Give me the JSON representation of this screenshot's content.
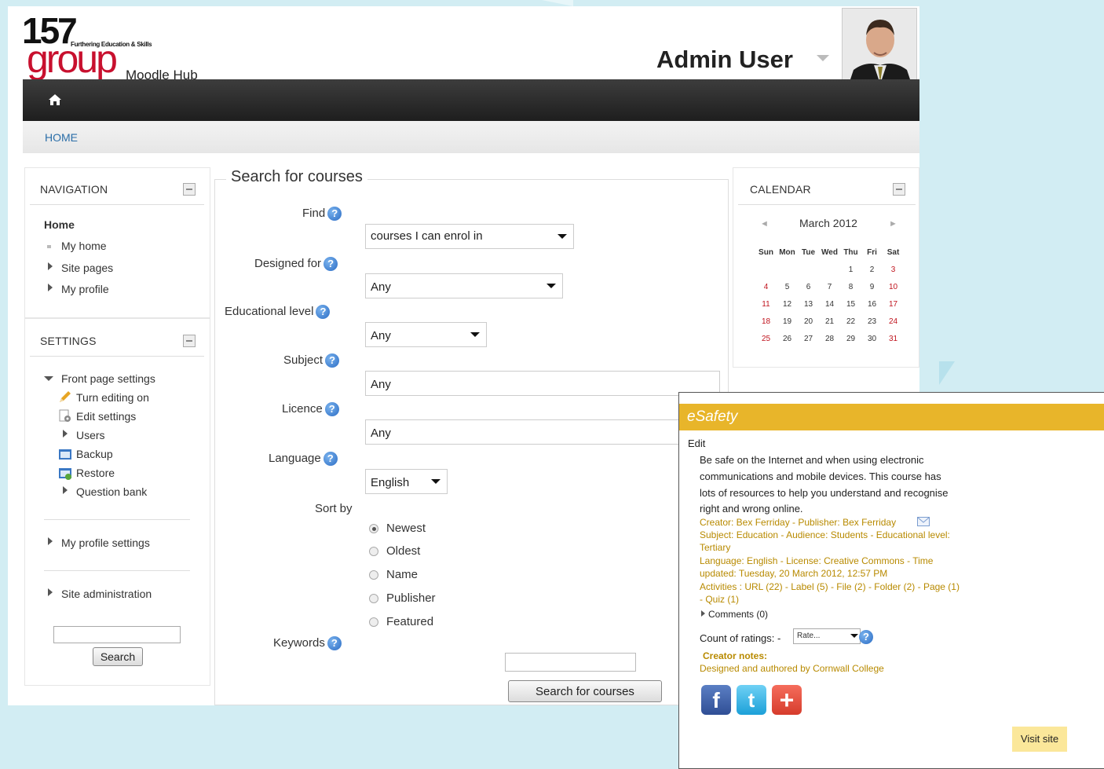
{
  "header": {
    "logo_number": "157",
    "logo_tagline": "Furthering Education & Skills",
    "logo_group": "group",
    "logo_sub": "Moodle Hub",
    "user_name": "Admin User"
  },
  "breadcrumb": {
    "home": "HOME"
  },
  "navigation": {
    "title": "NAVIGATION",
    "home": "Home",
    "items": [
      "My home",
      "Site pages",
      "My profile"
    ]
  },
  "settings": {
    "title": "SETTINGS",
    "front_page": "Front page settings",
    "items": [
      "Turn editing on",
      "Edit settings",
      "Users",
      "Backup",
      "Restore",
      "Question bank"
    ],
    "my_profile_settings": "My profile settings",
    "site_admin": "Site administration",
    "search_button": "Search"
  },
  "search_form": {
    "legend": "Search for courses",
    "find_label": "Find",
    "find_value": "courses I can enrol in",
    "designed_for_label": "Designed for",
    "designed_for_value": "Any",
    "edu_level_label": "Educational level",
    "edu_level_value": "Any",
    "subject_label": "Subject",
    "subject_value": "Any",
    "licence_label": "Licence",
    "licence_value": "Any",
    "language_label": "Language",
    "language_value": "English",
    "sort_label": "Sort by",
    "sort_options": [
      "Newest",
      "Oldest",
      "Name",
      "Publisher",
      "Featured"
    ],
    "sort_selected": "Newest",
    "keywords_label": "Keywords",
    "submit": "Search for courses",
    "help_glyph": "?"
  },
  "calendar": {
    "title": "CALENDAR",
    "month": "March 2012",
    "prev": "◄",
    "next": "►",
    "weekdays": [
      "Sun",
      "Mon",
      "Tue",
      "Wed",
      "Thu",
      "Fri",
      "Sat"
    ],
    "weeks": [
      [
        "",
        "",
        "",
        "",
        "1",
        "2",
        "3"
      ],
      [
        "4",
        "5",
        "6",
        "7",
        "8",
        "9",
        "10"
      ],
      [
        "11",
        "12",
        "13",
        "14",
        "15",
        "16",
        "17"
      ],
      [
        "18",
        "19",
        "20",
        "21",
        "22",
        "23",
        "24"
      ],
      [
        "25",
        "26",
        "27",
        "28",
        "29",
        "30",
        "31"
      ]
    ]
  },
  "popup": {
    "title": "eSafety",
    "edit": "Edit",
    "desc_lines": [
      "Be safe on the Internet and when using electronic",
      "communications and mobile devices. This course has",
      "lots of resources to help you understand and recognise",
      "right and wrong online."
    ],
    "meta_lines": [
      "Creator: Bex Ferriday - Publisher: Bex Ferriday",
      "Subject: Education - Audience: Students - Educational level:",
      "Tertiary",
      "Language: English - License: Creative Commons - Time",
      "updated: Tuesday, 20 March 2012, 12:57 PM",
      "Activities : URL (22) - Label (5) - File (2) - Folder (2) - Page (1)",
      "- Quiz (1)"
    ],
    "comments": "Comments (0)",
    "ratings_label": "Count of ratings: -",
    "rate_value": "Rate...",
    "creator_notes_label": "Creator notes:",
    "creator_notes": "Designed and authored by Cornwall College",
    "social": [
      "f",
      "t",
      "+"
    ],
    "visit_site": "Visit site"
  },
  "colors": {
    "accent_link": "#2b6ea8",
    "popup_header": "#e8b52a",
    "weekend": "#c0141e",
    "meta_gold": "#b88a00"
  }
}
